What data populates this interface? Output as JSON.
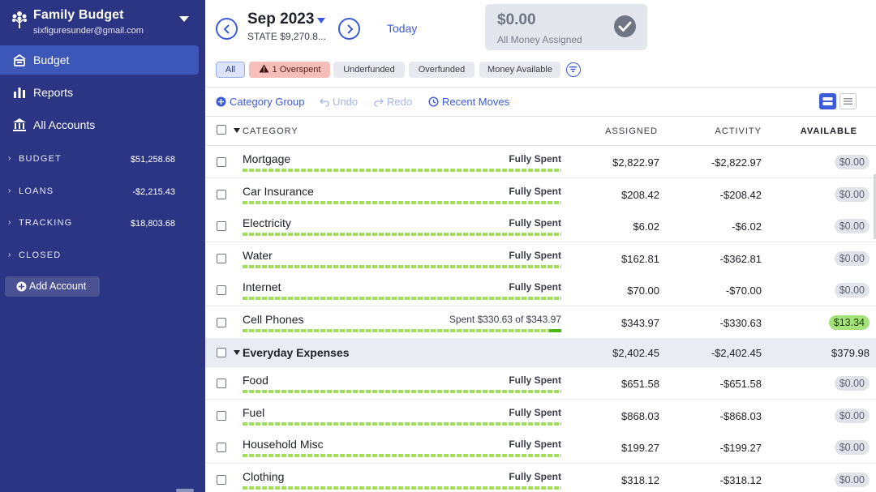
{
  "sidebar": {
    "budget_name": "Family Budget",
    "email": "sixfiguresunder@gmail.com",
    "nav": [
      {
        "label": "Budget",
        "icon": "budget-icon",
        "active": true
      },
      {
        "label": "Reports",
        "icon": "bar-chart-icon",
        "active": false
      },
      {
        "label": "All Accounts",
        "icon": "bank-icon",
        "active": false
      }
    ],
    "groups": [
      {
        "label": "BUDGET",
        "balance": "$51,258.68"
      },
      {
        "label": "LOANS",
        "balance": "-$2,215.43"
      },
      {
        "label": "TRACKING",
        "balance": "$18,803.68"
      },
      {
        "label": "CLOSED",
        "balance": ""
      }
    ],
    "add_account_label": "Add Account"
  },
  "header": {
    "month": "Sep 2023",
    "month_note": "STATE $9,270.8...",
    "today_label": "Today",
    "assigned_amount": "$0.00",
    "assigned_label": "All Money Assigned",
    "filters": [
      {
        "label": "All",
        "selected": true
      },
      {
        "label": "1 Overspent",
        "warn": true
      },
      {
        "label": "Underfunded"
      },
      {
        "label": "Overfunded"
      },
      {
        "label": "Money Available"
      }
    ]
  },
  "toolbar": {
    "category_group": "Category Group",
    "undo": "Undo",
    "redo": "Redo",
    "recent_moves": "Recent Moves"
  },
  "table": {
    "headers": {
      "category": "CATEGORY",
      "assigned": "ASSIGNED",
      "activity": "ACTIVITY",
      "available": "AVAILABLE"
    },
    "rows": [
      {
        "name": "Mortgage",
        "status": "Fully Spent",
        "assigned": "$2,822.97",
        "activity": "-$2,822.97",
        "available": "$0.00"
      },
      {
        "name": "Car Insurance",
        "status": "Fully Spent",
        "assigned": "$208.42",
        "activity": "-$208.42",
        "available": "$0.00"
      },
      {
        "name": "Electricity",
        "status": "Fully Spent",
        "assigned": "$6.02",
        "activity": "-$6.02",
        "available": "$0.00"
      },
      {
        "name": "Water",
        "status": "Fully Spent",
        "assigned": "$162.81",
        "activity": "-$362.81",
        "available": "$0.00"
      },
      {
        "name": "Internet",
        "status": "Fully Spent",
        "assigned": "$70.00",
        "activity": "-$70.00",
        "available": "$0.00"
      },
      {
        "name": "Cell Phones",
        "status": "Spent $330.63 of $343.97",
        "assigned": "$343.97",
        "activity": "-$330.63",
        "available": "$13.34",
        "spent_fraction": 0.961
      }
    ],
    "group": {
      "name": "Everyday Expenses",
      "assigned": "$2,402.45",
      "activity": "-$2,402.45",
      "available": "$379.98"
    },
    "group_rows": [
      {
        "name": "Food",
        "status": "Fully Spent",
        "assigned": "$651.58",
        "activity": "-$651.58",
        "available": "$0.00"
      },
      {
        "name": "Fuel",
        "status": "Fully Spent",
        "assigned": "$868.03",
        "activity": "-$868.03",
        "available": "$0.00"
      },
      {
        "name": "Household Misc",
        "status": "Fully Spent",
        "assigned": "$199.27",
        "activity": "-$199.27",
        "available": "$0.00"
      },
      {
        "name": "Clothing",
        "status": "Fully Spent",
        "assigned": "$318.12",
        "activity": "-$318.12",
        "available": "$0.00"
      }
    ]
  },
  "colors": {
    "sidebar": "#2b3583",
    "accent": "#3b5bd9",
    "progress": "#9ee05a",
    "available_positive": "#a3e37a",
    "overspent": "#f7bdb8"
  }
}
